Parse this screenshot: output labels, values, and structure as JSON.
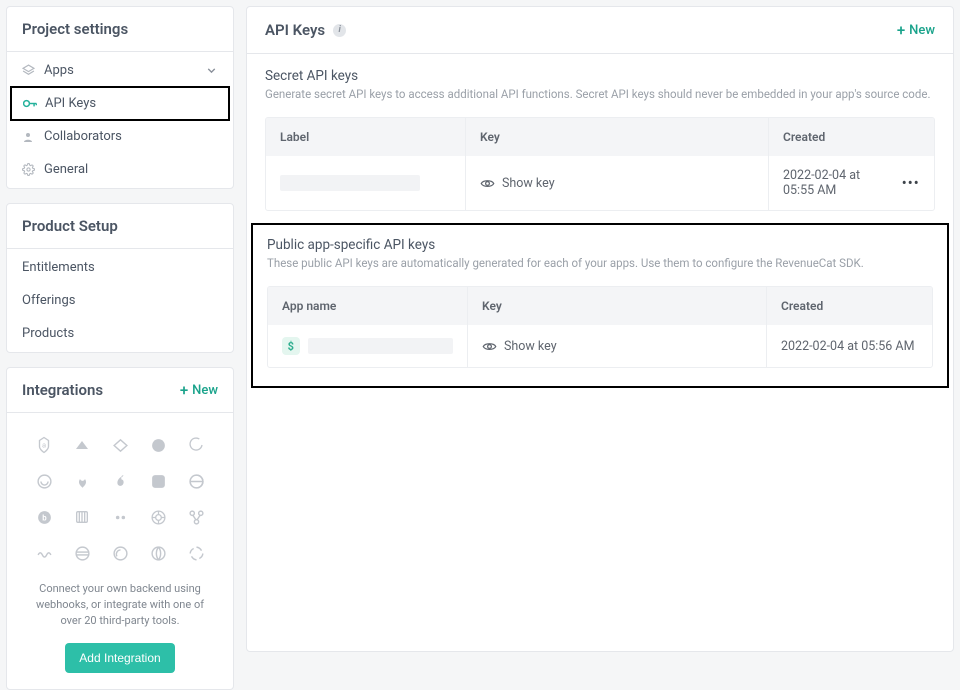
{
  "sidebar": {
    "project_settings": {
      "title": "Project settings",
      "items": [
        {
          "label": "Apps",
          "icon": "layers"
        },
        {
          "label": "API Keys",
          "icon": "key"
        },
        {
          "label": "Collaborators",
          "icon": "person"
        },
        {
          "label": "General",
          "icon": "gear"
        }
      ]
    },
    "product_setup": {
      "title": "Product Setup",
      "items": [
        {
          "label": "Entitlements"
        },
        {
          "label": "Offerings"
        },
        {
          "label": "Products"
        }
      ]
    },
    "integrations": {
      "title": "Integrations",
      "new_label": "New",
      "description": "Connect your own backend using webhooks, or integrate with one of over 20 third-party tools.",
      "button_label": "Add Integration"
    }
  },
  "main": {
    "header": {
      "title": "API Keys",
      "new_label": "New"
    },
    "secret": {
      "title": "Secret API keys",
      "description": "Generate secret API keys to access additional API functions. Secret API keys should never be embedded in your app's source code.",
      "columns": [
        "Label",
        "Key",
        "Created"
      ],
      "rows": [
        {
          "show_key_label": "Show key",
          "created": "2022-02-04 at 05:55 AM"
        }
      ]
    },
    "public": {
      "title": "Public app-specific API keys",
      "description": "These public API keys are automatically generated for each of your apps. Use them to configure the RevenueCat SDK.",
      "columns": [
        "App name",
        "Key",
        "Created"
      ],
      "rows": [
        {
          "app_glyph": "$",
          "show_key_label": "Show key",
          "created": "2022-02-04 at 05:56 AM"
        }
      ]
    }
  }
}
